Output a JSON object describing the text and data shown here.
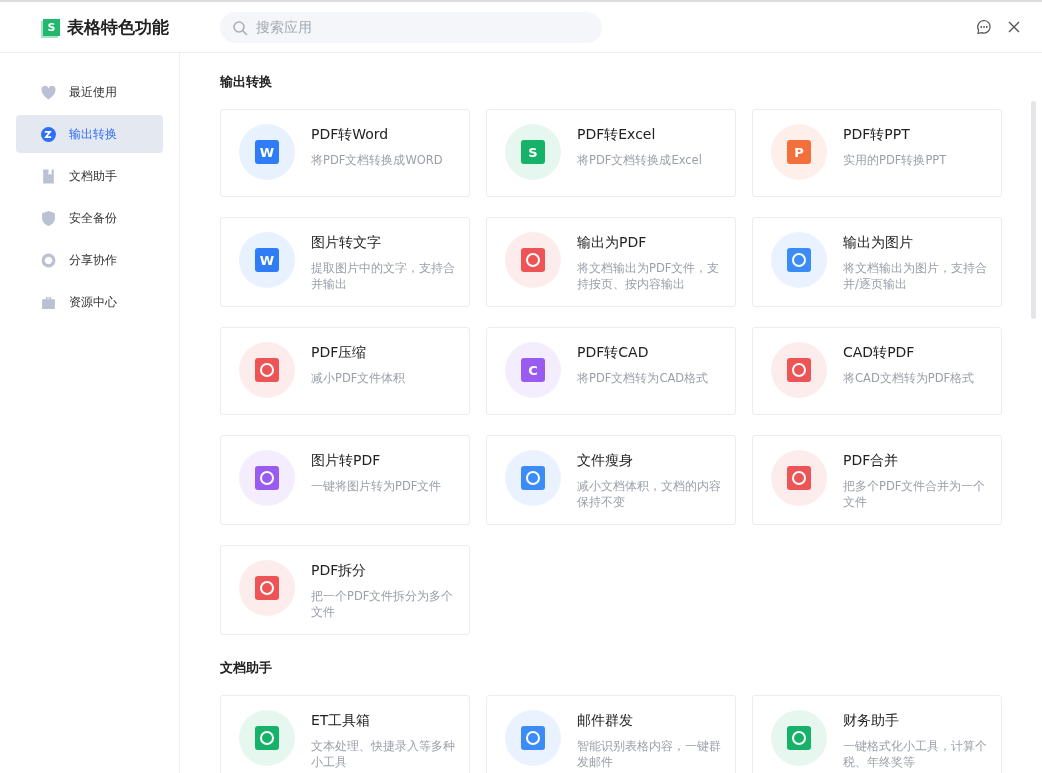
{
  "window": {
    "title": "表格特色功能",
    "logo_letter": "S"
  },
  "search": {
    "placeholder": "搜索应用"
  },
  "sidebar": {
    "items": [
      {
        "label": "最近使用",
        "selected": false
      },
      {
        "label": "输出转换",
        "selected": true
      },
      {
        "label": "文档助手",
        "selected": false
      },
      {
        "label": "安全备份",
        "selected": false
      },
      {
        "label": "分享协作",
        "selected": false
      },
      {
        "label": "资源中心",
        "selected": false
      }
    ]
  },
  "sections": [
    {
      "title": "输出转换",
      "cards": [
        {
          "title": "PDF转Word",
          "description": "将PDF文档转换成WORD",
          "color": "#2f7cf6",
          "letter": "W"
        },
        {
          "title": "PDF转Excel",
          "description": "将PDF文档转换成Excel",
          "color": "#17b26a",
          "letter": "S"
        },
        {
          "title": "PDF转PPT",
          "description": "实用的PDF转换PPT",
          "color": "#f2703c",
          "letter": "P"
        },
        {
          "title": "图片转文字",
          "description": "提取图片中的文字，支持合并输出",
          "color": "#2f7cf6",
          "letter": "W"
        },
        {
          "title": "输出为PDF",
          "description": "将文档输出为PDF文件，支持按页、按内容输出",
          "color": "#ec5456"
        },
        {
          "title": "输出为图片",
          "description": "将文档输出为图片，支持合并/逐页输出",
          "color": "#3b8cf7"
        },
        {
          "title": "PDF压缩",
          "description": "减小PDF文件体积",
          "color": "#ec5456"
        },
        {
          "title": "PDF转CAD",
          "description": "将PDF文档转为CAD格式",
          "color": "#9a5cf0",
          "letter": "C"
        },
        {
          "title": "CAD转PDF",
          "description": "将CAD文档转为PDF格式",
          "color": "#ec5456"
        },
        {
          "title": "图片转PDF",
          "description": "一键将图片转为PDF文件",
          "color": "#9a5cf0"
        },
        {
          "title": "文件瘦身",
          "description": "减小文档体积，文档的内容保持不变",
          "color": "#3b8cf7"
        },
        {
          "title": "PDF合并",
          "description": "把多个PDF文件合并为一个文件",
          "color": "#ec5456"
        },
        {
          "title": "PDF拆分",
          "description": "把一个PDF文件拆分为多个文件",
          "color": "#ec5456"
        }
      ]
    },
    {
      "title": "文档助手",
      "cards": [
        {
          "title": "ET工具箱",
          "description": "文本处理、快捷录入等多种小工具",
          "color": "#17b26a"
        },
        {
          "title": "邮件群发",
          "description": "智能识别表格内容，一键群发邮件",
          "color": "#3b8cf7"
        },
        {
          "title": "财务助手",
          "description": "一键格式化小工具，计算个税、年终奖等",
          "color": "#17b26a"
        }
      ]
    }
  ]
}
